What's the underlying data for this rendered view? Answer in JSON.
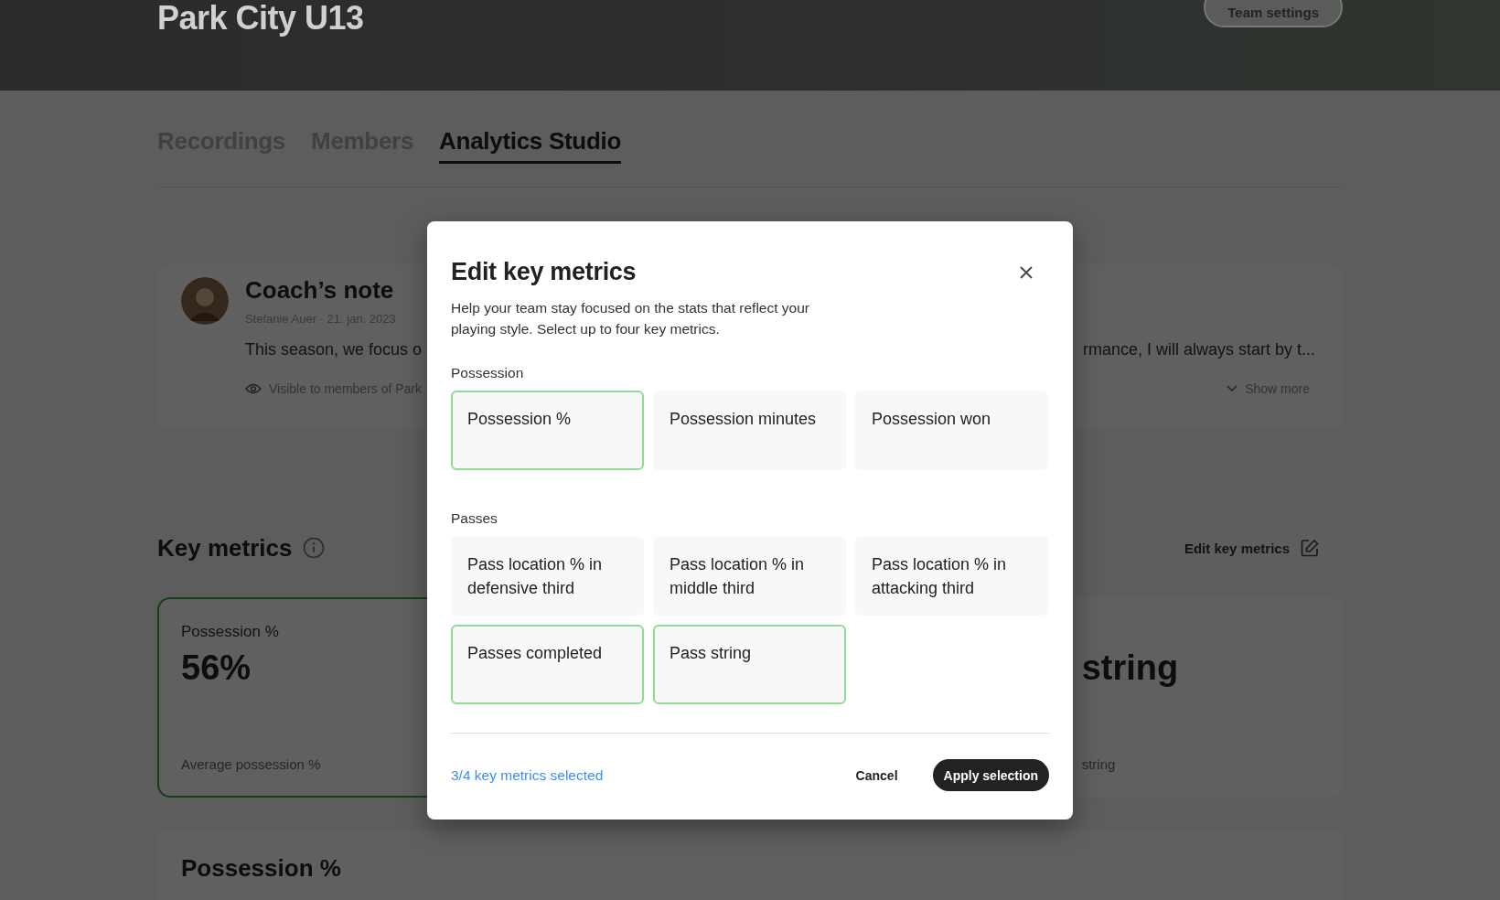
{
  "header": {
    "title": "Park City U13",
    "button": "Team settings"
  },
  "tabs": [
    {
      "label": "Recordings",
      "selected": false
    },
    {
      "label": "Members",
      "selected": false
    },
    {
      "label": "Analytics Studio",
      "selected": true
    }
  ],
  "coach_note": {
    "title": "Coach’s note",
    "meta": "Stefanie Auer · 21. jan. 2023",
    "body_start": "This season, we focus o",
    "body_end": "rmance, I will always start by t...",
    "visibility": "Visible to members of Park",
    "show_more": "Show more"
  },
  "key_metrics": {
    "title": "Key metrics",
    "edit_button": "Edit key metrics",
    "cards": [
      {
        "title": "Possession %",
        "value": "56%",
        "caption": "Average possession %",
        "selected": true
      },
      {
        "value": "string",
        "caption": "string",
        "selected": false
      }
    ]
  },
  "detail": {
    "title": "Possession %"
  },
  "modal": {
    "title": "Edit key metrics",
    "description": "Help your team stay focused on the stats that reflect your playing style. Select up to four key metrics.",
    "sections": [
      {
        "label": "Possession",
        "options": [
          {
            "label": "Possession %",
            "selected": true
          },
          {
            "label": "Possession minutes",
            "selected": false
          },
          {
            "label": "Possession won",
            "selected": false
          }
        ]
      },
      {
        "label": "Passes",
        "options": [
          {
            "label": "Pass location % in defensive third",
            "selected": false
          },
          {
            "label": "Pass location % in middle third",
            "selected": false
          },
          {
            "label": "Pass location % in attacking third",
            "selected": false
          },
          {
            "label": "Passes completed",
            "selected": true
          },
          {
            "label": "Pass string",
            "selected": true
          }
        ]
      }
    ],
    "status": "3/4 key metrics selected",
    "cancel": "Cancel",
    "apply": "Apply selection"
  }
}
